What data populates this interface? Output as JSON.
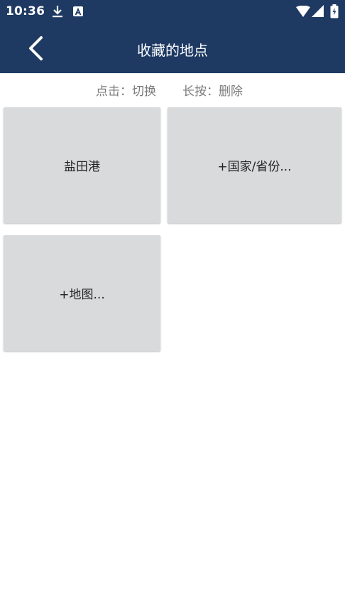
{
  "status_bar": {
    "time": "10:36",
    "icons": [
      "download-icon",
      "a-badge-icon",
      "wifi-icon",
      "signal-icon",
      "battery-charging-icon"
    ]
  },
  "app_bar": {
    "title": "收藏的地点",
    "back_icon": "chevron-left-icon"
  },
  "hint": {
    "tap": "点击：切换",
    "long_press": "长按：删除"
  },
  "tiles": [
    {
      "label": "盐田港"
    },
    {
      "label": "+国家/省份..."
    },
    {
      "label": "+地图..."
    }
  ],
  "colors": {
    "header_bg": "#1e3a63",
    "tile_bg": "#d9dadb",
    "hint_text": "#7a7a7a"
  }
}
